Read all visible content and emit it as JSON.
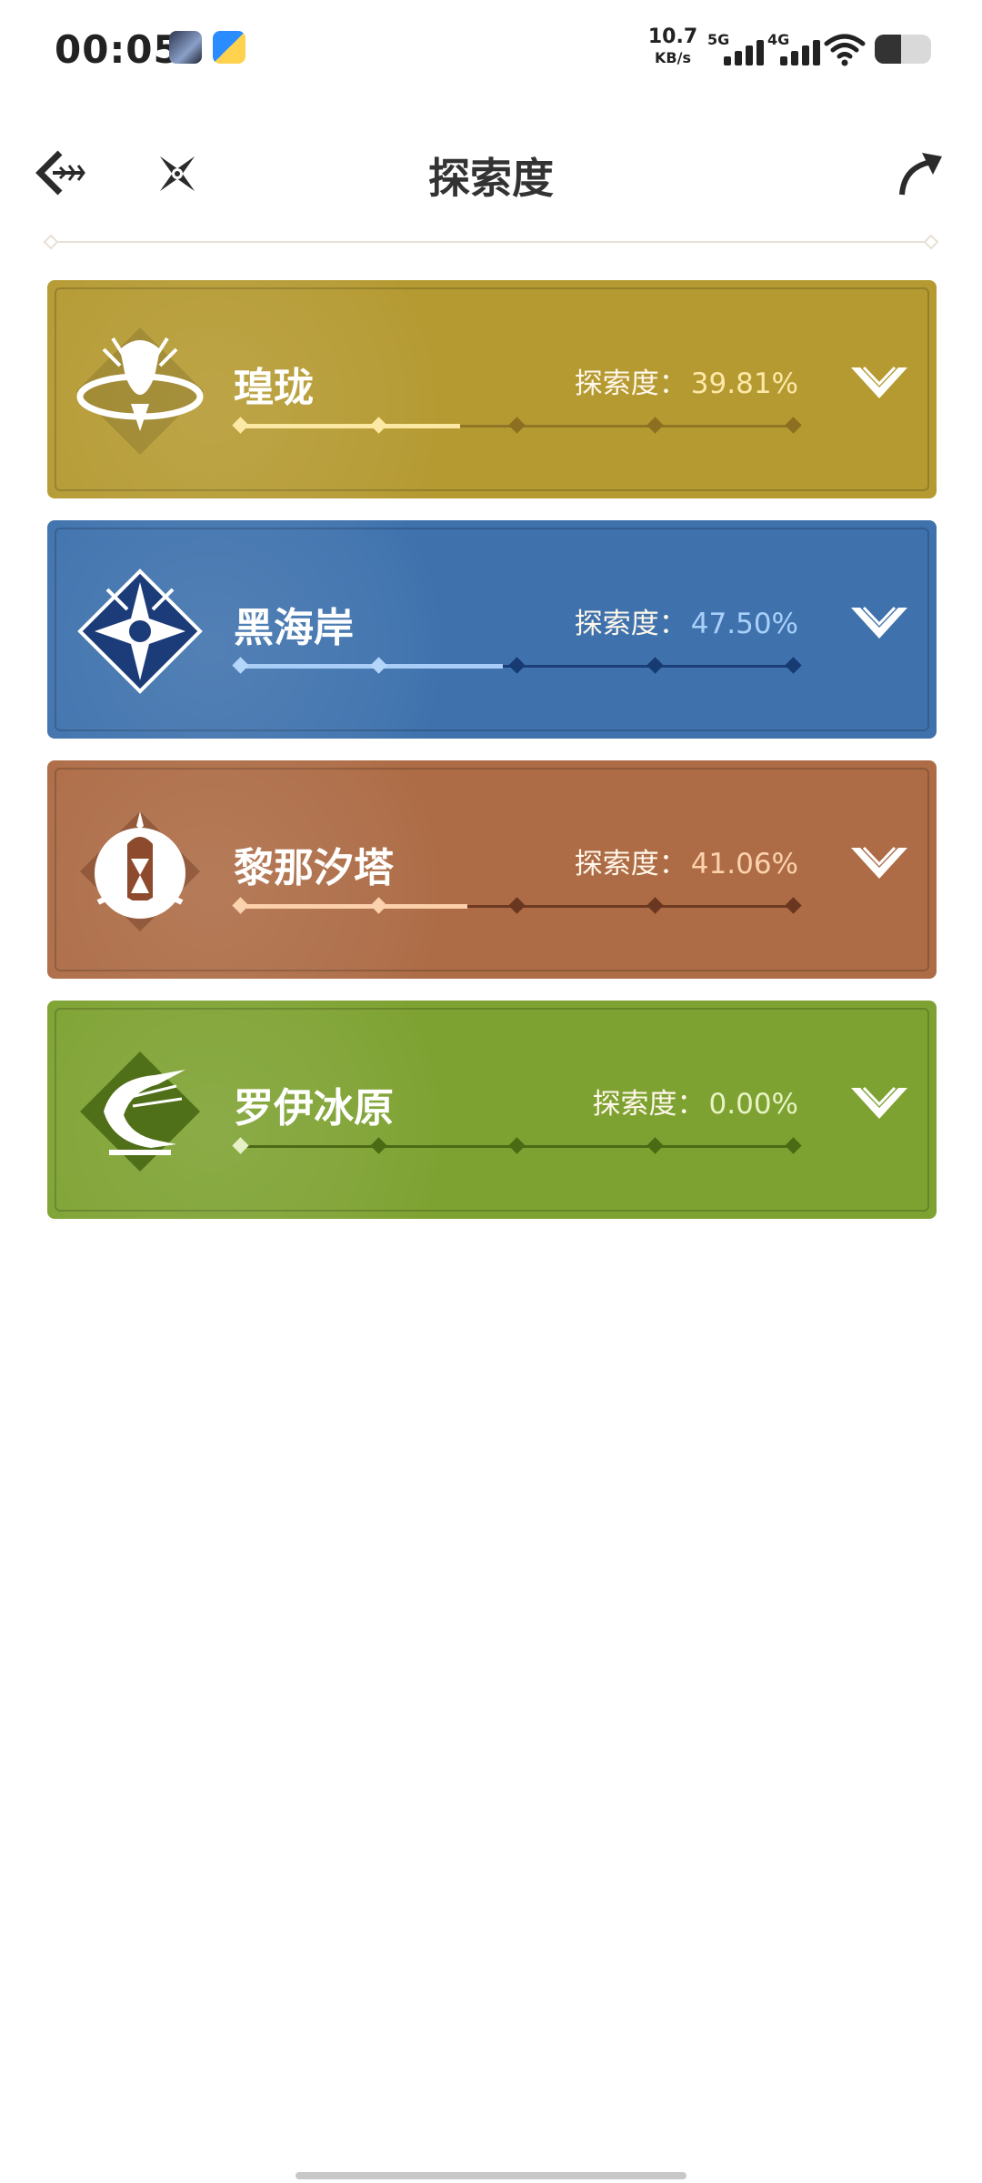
{
  "status_bar": {
    "time": "00:05",
    "net_speed_value": "10.7",
    "net_speed_unit": "KB/s",
    "sim1": "5G",
    "sim2": "4G",
    "battery_level": 0.46
  },
  "header": {
    "title": "探索度",
    "back_icon": "back-arrow-icon",
    "compass_icon": "compass-star-icon",
    "share_icon": "share-arrow-icon"
  },
  "regions": [
    {
      "name": "瑝珑",
      "label": "探索度：",
      "percent": "39.81%",
      "progress": 0.3981,
      "color": "#b59a32",
      "fill": "#fbe9a3",
      "base": "#8f7525",
      "node_done": "#fde9a6",
      "node_todo": "#8c6f20",
      "pct_color": "#fde8a8",
      "emblem_icon": "huanglong-dragon-emblem-icon"
    },
    {
      "name": "黑海岸",
      "label": "探索度：",
      "percent": "47.50%",
      "progress": 0.475,
      "color": "#3f72ad",
      "fill": "#a8cdf6",
      "base": "#1c3f7a",
      "node_done": "#b5d6fb",
      "node_todo": "#163a72",
      "pct_color": "#a9d0fa",
      "emblem_icon": "black-shores-star-emblem-icon"
    },
    {
      "name": "黎那汐塔",
      "label": "探索度：",
      "percent": "41.06%",
      "progress": 0.4106,
      "color": "#ad6c46",
      "fill": "#fbd0aa",
      "base": "#6e3a22",
      "node_done": "#fbd2ae",
      "node_todo": "#6a3620",
      "pct_color": "#fcd2ad",
      "emblem_icon": "rinascita-tower-emblem-icon"
    },
    {
      "name": "罗伊冰原",
      "label": "探索度：",
      "percent": "0.00%",
      "progress": 0.0,
      "color": "#7ea232",
      "fill": "#e6f1c6",
      "base": "#4c6a16",
      "node_done": "#e6f1c6",
      "node_todo": "#4a6a14",
      "pct_color": "#e8f3c4",
      "emblem_icon": "roya-frostlands-emblem-icon"
    }
  ],
  "expand_icon": "chevron-down-icon"
}
